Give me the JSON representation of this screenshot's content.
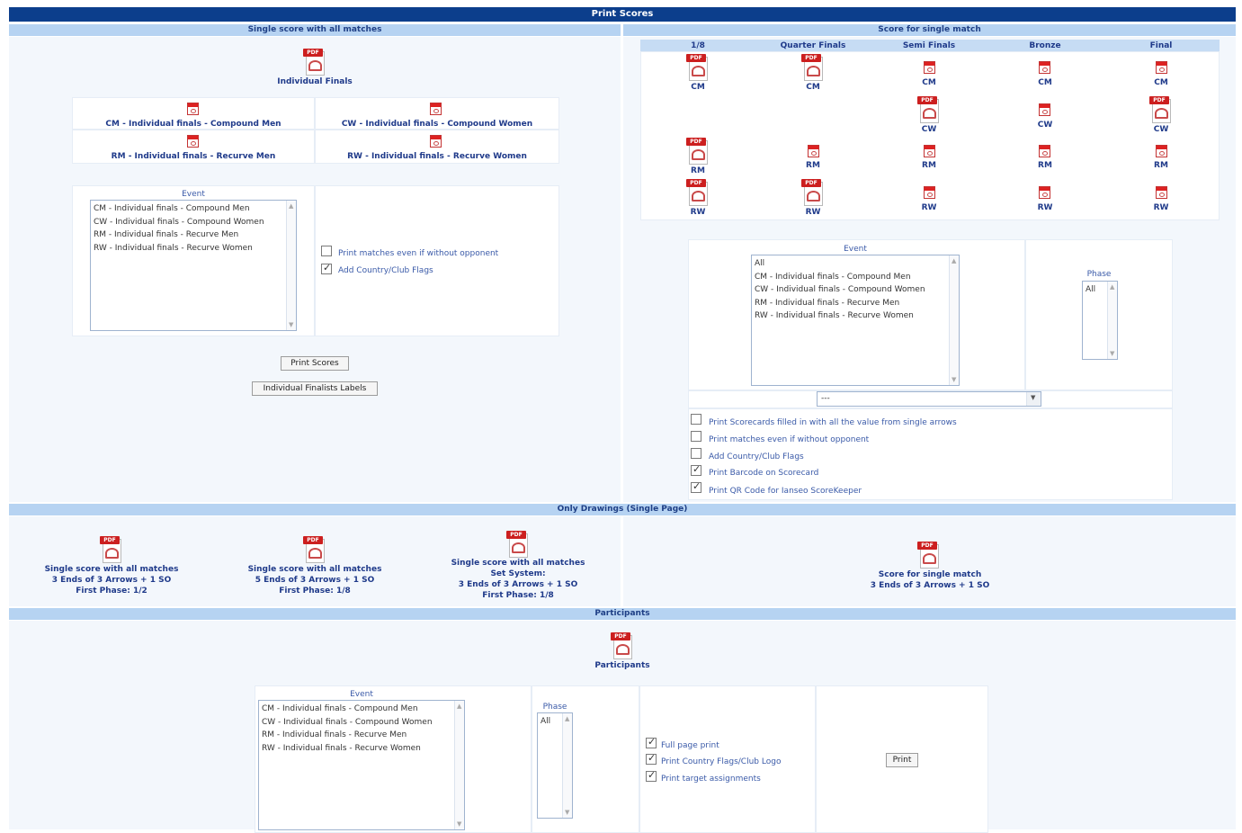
{
  "title": "Print Scores",
  "sections": {
    "single_all": "Single score with all matches",
    "single_match": "Score for single match",
    "drawings": "Only Drawings (Single Page)",
    "participants": "Participants"
  },
  "left": {
    "main_pdf_label": "Individual Finals",
    "event_links": [
      "CM - Individual finals - Compound Men",
      "CW - Individual finals - Compound Women",
      "RM - Individual finals - Recurve Men",
      "RW - Individual finals - Recurve Women"
    ],
    "event_label": "Event",
    "events": [
      "CM - Individual finals - Compound Men",
      "CW - Individual finals - Compound Women",
      "RM - Individual finals - Recurve Men",
      "RW - Individual finals - Recurve Women"
    ],
    "opt_without_opponent": "Print matches even if without opponent",
    "opt_flags": "Add Country/Club Flags",
    "btn_print_scores": "Print Scores",
    "btn_labels": "Individual Finalists Labels"
  },
  "right": {
    "phases": [
      "1/8",
      "Quarter Finals",
      "Semi Finals",
      "Bronze",
      "Final"
    ],
    "rows": [
      [
        "CM",
        "CM",
        "CM",
        "CM",
        "CM"
      ],
      [
        "",
        "",
        "CW",
        "CW",
        "CW"
      ],
      [
        "RM",
        "RM",
        "RM",
        "RM",
        "RM"
      ],
      [
        "RW",
        "RW",
        "RW",
        "RW",
        "RW"
      ]
    ],
    "event_label": "Event",
    "events": [
      "All",
      "CM - Individual finals - Compound Men",
      "CW - Individual finals - Compound Women",
      "RM - Individual finals - Recurve Men",
      "RW - Individual finals - Recurve Women"
    ],
    "phase_label": "Phase",
    "phase_options": [
      "All"
    ],
    "select_value": "---",
    "opt_filled": "Print Scorecards filled in with all the value from single arrows",
    "opt_without_opponent": "Print matches even if without opponent",
    "opt_flags": "Add Country/Club Flags",
    "opt_barcode": "Print Barcode on Scorecard",
    "opt_qr": "Print QR Code for Ianseo ScoreKeeper"
  },
  "drawings": [
    {
      "l1": "Single score with all matches",
      "l2": "3 Ends of 3 Arrows + 1 SO",
      "l3": "First Phase: 1/2"
    },
    {
      "l1": "Single score with all matches",
      "l2": "5 Ends of 3 Arrows + 1 SO",
      "l3": "First Phase: 1/8"
    },
    {
      "l1": "Single score with all matches",
      "l2": "Set System:",
      "l3": "3 Ends of 3 Arrows + 1 SO",
      "l4": "First Phase: 1/8"
    },
    {
      "l1": "Score for single match",
      "l2": "3 Ends of 3 Arrows + 1 SO"
    }
  ],
  "participants": {
    "pdf_label": "Participants",
    "event_label": "Event",
    "events": [
      "CM - Individual finals - Compound Men",
      "CW - Individual finals - Compound Women",
      "RM - Individual finals - Recurve Men",
      "RW - Individual finals - Recurve Women"
    ],
    "phase_label": "Phase",
    "phase_options": [
      "All"
    ],
    "opt_full_page": "Full page print",
    "opt_country_flags": "Print Country Flags/Club Logo",
    "opt_target": "Print target assignments",
    "btn_print": "Print"
  }
}
